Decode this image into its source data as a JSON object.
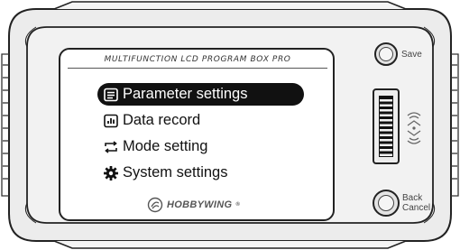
{
  "device": {
    "screen_title": "MULTIFUNCTION LCD PROGRAM BOX PRO",
    "brand": "HOBBYWING",
    "brand_mark": "®"
  },
  "menu": {
    "items": [
      {
        "label": "Parameter settings",
        "icon": "document-icon",
        "selected": true
      },
      {
        "label": "Data record",
        "icon": "bar-chart-icon",
        "selected": false
      },
      {
        "label": "Mode setting",
        "icon": "swap-arrows-icon",
        "selected": false
      },
      {
        "label": "System settings",
        "icon": "gear-icon",
        "selected": false
      }
    ]
  },
  "buttons": {
    "save_label": "Save",
    "back_label_line1": "Back",
    "back_label_line2": "Cancel"
  },
  "colors": {
    "body": "#e9e9e9",
    "outline": "#222222",
    "selection": "#111111"
  }
}
